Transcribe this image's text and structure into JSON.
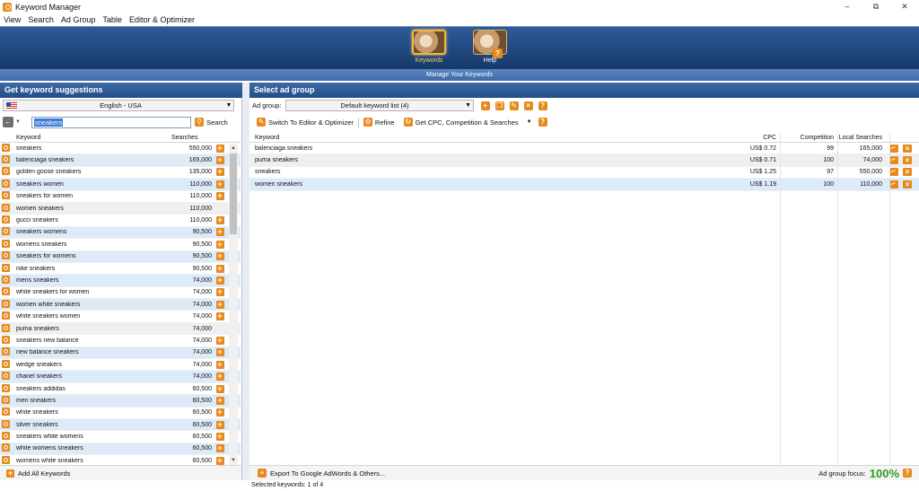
{
  "window": {
    "title": "Keyword Manager",
    "minimize": "–",
    "restore": "⧉",
    "close": "✕"
  },
  "menu": [
    "View",
    "Search",
    "Ad Group",
    "Table",
    "Editor & Optimizer"
  ],
  "nav": {
    "keywords_label": "Keywords",
    "help_label": "Help",
    "subtitle": "Manage Your Keywords"
  },
  "left": {
    "header": "Get keyword suggestions",
    "language": "English - USA",
    "search_value": "sneakers",
    "search_button": "Search",
    "columns": {
      "keyword": "Keyword",
      "searches": "Searches"
    },
    "rows": [
      {
        "keyword": "sneakers",
        "searches": "550,000"
      },
      {
        "keyword": "balenciaga sneakers",
        "searches": "165,000"
      },
      {
        "keyword": "golden goose sneakers",
        "searches": "135,000"
      },
      {
        "keyword": "sneakers women",
        "searches": "110,000"
      },
      {
        "keyword": "sneakers for women",
        "searches": "110,000"
      },
      {
        "keyword": "women sneakers",
        "searches": "110,000"
      },
      {
        "keyword": "gucci sneakers",
        "searches": "110,000"
      },
      {
        "keyword": "sneakers womens",
        "searches": "90,500"
      },
      {
        "keyword": "womens sneakers",
        "searches": "90,500"
      },
      {
        "keyword": "sneakers for womens",
        "searches": "90,500"
      },
      {
        "keyword": "nike sneakers",
        "searches": "90,500"
      },
      {
        "keyword": "mens sneakers",
        "searches": "74,000"
      },
      {
        "keyword": "white sneakers for women",
        "searches": "74,000"
      },
      {
        "keyword": "women white sneakers",
        "searches": "74,000"
      },
      {
        "keyword": "white sneakers women",
        "searches": "74,000"
      },
      {
        "keyword": "puma sneakers",
        "searches": "74,000"
      },
      {
        "keyword": "sneakers new balance",
        "searches": "74,000"
      },
      {
        "keyword": "new balance sneakers",
        "searches": "74,000"
      },
      {
        "keyword": "wedge sneakers",
        "searches": "74,000"
      },
      {
        "keyword": "chanel sneakers",
        "searches": "74,000"
      },
      {
        "keyword": "sneakers addidas",
        "searches": "60,500"
      },
      {
        "keyword": "men sneakers",
        "searches": "60,500"
      },
      {
        "keyword": "white sneakers",
        "searches": "60,500"
      },
      {
        "keyword": "silver sneakers",
        "searches": "60,500"
      },
      {
        "keyword": "sneakers white womens",
        "searches": "60,500"
      },
      {
        "keyword": "white womens sneakers",
        "searches": "60,500"
      },
      {
        "keyword": "womens white sneakers",
        "searches": "60,500"
      }
    ],
    "add_all": "Add All Keywords"
  },
  "right": {
    "header": "Select ad group",
    "adgroup_label": "Ad group:",
    "adgroup_value": "Default keyword list (4)",
    "toolbar": {
      "switch": "Switch To Editor & Optimizer",
      "refine": "Refine",
      "get_cpc": "Get CPC, Competition & Searches"
    },
    "columns": {
      "keyword": "Keyword",
      "cpc": "CPC",
      "competition": "Competition",
      "local": "Local Searches"
    },
    "rows": [
      {
        "keyword": "balenciaga sneakers",
        "cpc": "US$ 0.72",
        "competition": "99",
        "local": "165,000"
      },
      {
        "keyword": "puma sneakers",
        "cpc": "US$ 0.71",
        "competition": "100",
        "local": "74,000"
      },
      {
        "keyword": "sneakers",
        "cpc": "US$ 1.25",
        "competition": "97",
        "local": "550,000"
      },
      {
        "keyword": "women sneakers",
        "cpc": "US$ 1.19",
        "competition": "100",
        "local": "110,000"
      }
    ],
    "export": "Export To Google AdWords & Others...",
    "focus_label": "Ad group focus:",
    "focus_value": "100%"
  },
  "status": "Selected keywords: 1 of 4"
}
